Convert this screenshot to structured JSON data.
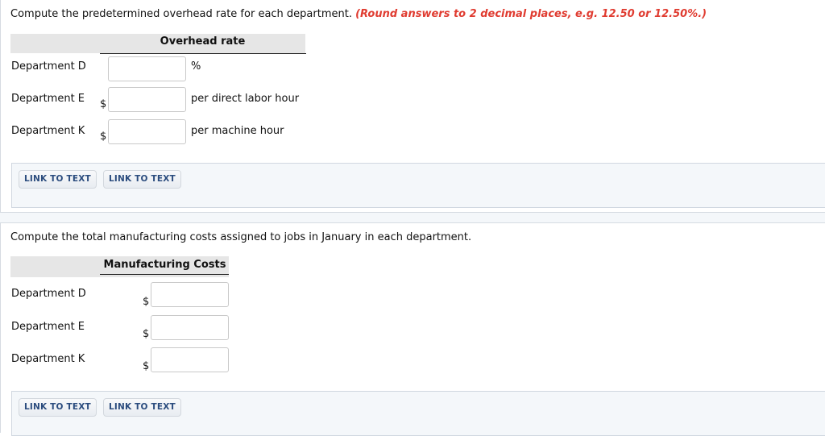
{
  "part1": {
    "instruction": "Compute the predetermined overhead rate for each department.",
    "note": "(Round answers to 2 decimal places, e.g. 12.50 or 12.50%.)",
    "column_header": "Overhead rate",
    "rows": [
      {
        "label": "Department D",
        "prefix": "",
        "value": "",
        "unit": "%"
      },
      {
        "label": "Department E",
        "prefix": "$",
        "value": "",
        "unit": "per direct labor hour"
      },
      {
        "label": "Department K",
        "prefix": "$",
        "value": "",
        "unit": "per machine hour"
      }
    ],
    "links": [
      "LINK TO TEXT",
      "LINK TO TEXT"
    ]
  },
  "part2": {
    "instruction": "Compute the total manufacturing costs assigned to jobs in January in each department.",
    "column_header": "Manufacturing Costs",
    "rows": [
      {
        "label": "Department D",
        "prefix": "$",
        "value": ""
      },
      {
        "label": "Department E",
        "prefix": "$",
        "value": ""
      },
      {
        "label": "Department K",
        "prefix": "$",
        "value": ""
      }
    ],
    "links": [
      "LINK TO TEXT",
      "LINK TO TEXT"
    ]
  }
}
